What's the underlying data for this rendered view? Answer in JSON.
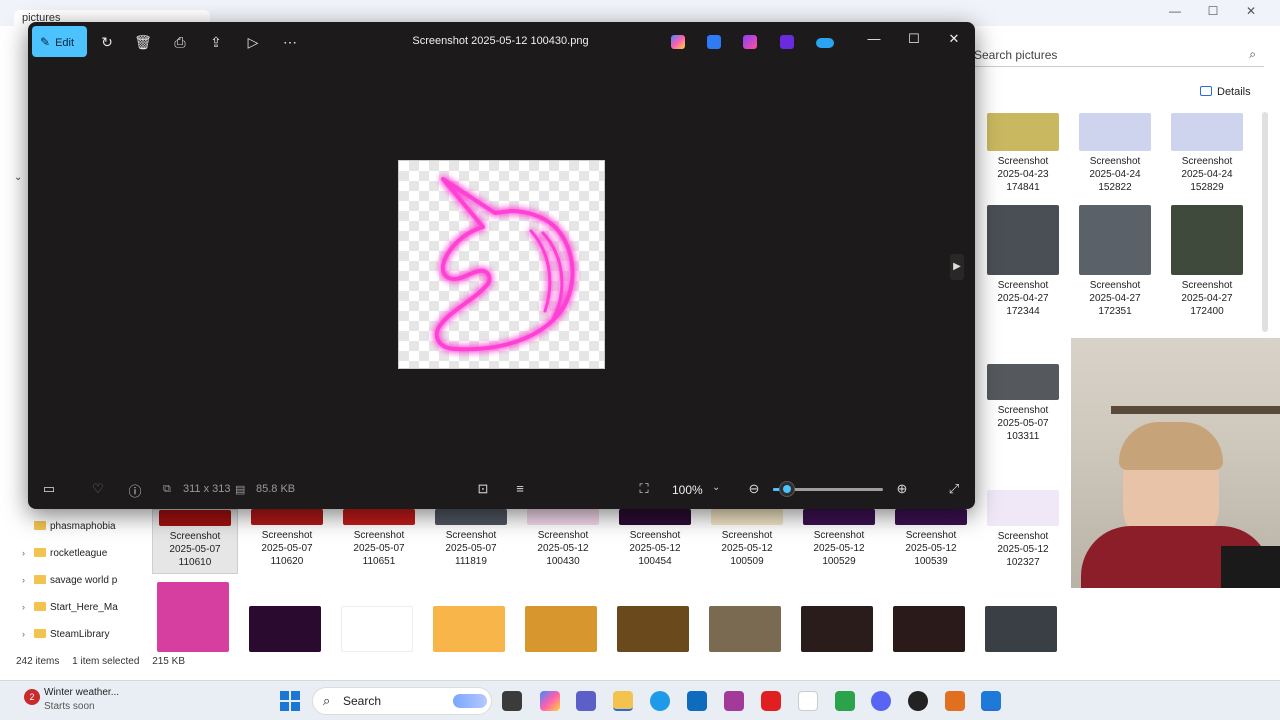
{
  "explorer": {
    "tab_label": "pictures",
    "search_placeholder": "Search pictures",
    "details_label": "Details",
    "right_grid": [
      {
        "line1": "Screenshot",
        "line2": "2025-04-23",
        "line3": "174841",
        "color": "#c9b860"
      },
      {
        "line1": "Screenshot",
        "line2": "2025-04-24",
        "line3": "152822",
        "color": "#cfd4ee"
      },
      {
        "line1": "Screenshot",
        "line2": "2025-04-24",
        "line3": "152829",
        "color": "#cfd4ee"
      },
      {
        "line1": "Screenshot",
        "line2": "2025-04-27",
        "line3": "172344",
        "color": "#4a4f55"
      },
      {
        "line1": "Screenshot",
        "line2": "2025-04-27",
        "line3": "172351",
        "color": "#5b6168"
      },
      {
        "line1": "Screenshot",
        "line2": "2025-04-27",
        "line3": "172400",
        "color": "#3f4a3d"
      },
      {
        "line1": "Screenshot",
        "line2": "2025-05-07",
        "line3": "103311",
        "color": "#55585c"
      }
    ],
    "bottom_row": [
      {
        "line1": "Screenshot",
        "line2": "2025-05-07",
        "line3": "110610",
        "color": "#a01010",
        "selected": true
      },
      {
        "line1": "Screenshot",
        "line2": "2025-05-07",
        "line3": "110620",
        "color": "#b01818"
      },
      {
        "line1": "Screenshot",
        "line2": "2025-05-07",
        "line3": "110651",
        "color": "#c01a1a"
      },
      {
        "line1": "Screenshot",
        "line2": "2025-05-07",
        "line3": "111819",
        "color": "#4f5560"
      },
      {
        "line1": "Screenshot",
        "line2": "2025-05-12",
        "line3": "100430",
        "color": "#f5d9ec"
      },
      {
        "line1": "Screenshot",
        "line2": "2025-05-12",
        "line3": "100454",
        "color": "#2a0c33"
      },
      {
        "line1": "Screenshot",
        "line2": "2025-05-12",
        "line3": "100509",
        "color": "#f3e6c6"
      },
      {
        "line1": "Screenshot",
        "line2": "2025-05-12",
        "line3": "100529",
        "color": "#3a1050"
      },
      {
        "line1": "Screenshot",
        "line2": "2025-05-12",
        "line3": "100539",
        "color": "#3a1050"
      },
      {
        "line1": "Screenshot",
        "line2": "2025-05-12",
        "line3": "102327",
        "color": "#f1e8f7"
      }
    ],
    "last_row": [
      {
        "color": "#d63ea0"
      },
      {
        "color": "#2a0a2e"
      },
      {
        "color": "#ffffff"
      },
      {
        "color": "#f7b54a"
      },
      {
        "color": "#d8962e"
      },
      {
        "color": "#6a4a1c"
      },
      {
        "color": "#7a6a52"
      },
      {
        "color": "#2b1c1c"
      },
      {
        "color": "#2a1a1a"
      },
      {
        "color": "#3a3f45"
      }
    ],
    "sidebar": [
      {
        "label": "phasmaphobia"
      },
      {
        "label": "rocketleague"
      },
      {
        "label": "savage world p"
      },
      {
        "label": "Start_Here_Ma"
      },
      {
        "label": "SteamLibrary"
      }
    ],
    "status": {
      "items": "242 items",
      "selection": "1 item selected",
      "size": "215 KB"
    }
  },
  "photos": {
    "edit_label": "Edit",
    "file_name": "Screenshot 2025-05-12 100430.png",
    "toolbar_icons": [
      "rotate-icon",
      "delete-icon",
      "print-icon",
      "share-icon",
      "slideshow-icon",
      "more-icon"
    ],
    "app_icons": [
      "copilot-icon",
      "designer-icon",
      "clipchamp-icon",
      "premiere-icon",
      "onedrive-icon"
    ],
    "image_dimensions": "311 x 313",
    "file_size": "85.8 KB",
    "zoom": "100%",
    "zoom_fraction": 0.13,
    "accent": "#4cc2ff",
    "neon_color": "#ff3fd5"
  },
  "taskbar": {
    "weather_badge": "2",
    "weather_title": "Winter weather...",
    "weather_sub": "Starts soon",
    "search_label": "Search"
  }
}
